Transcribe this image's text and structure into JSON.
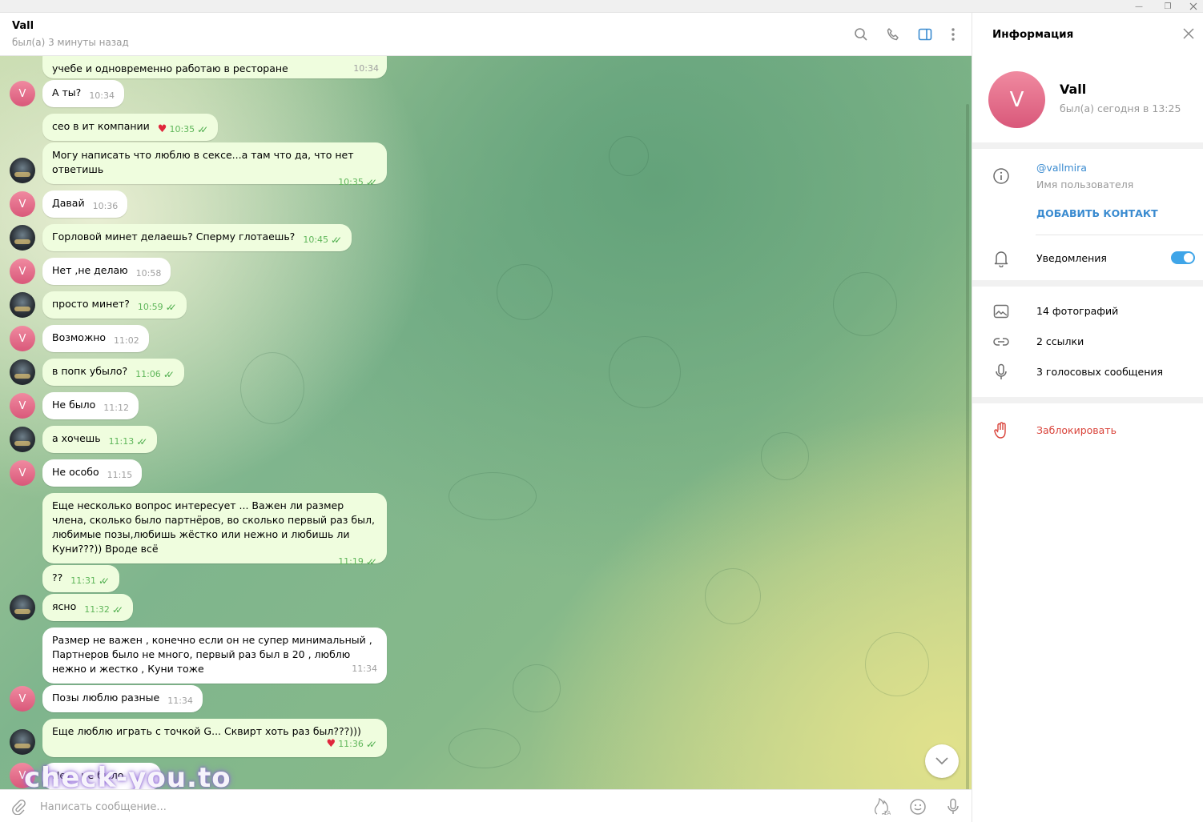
{
  "window": {
    "minimize_glyph": "—",
    "maximize_glyph": "❐"
  },
  "header": {
    "title": "Vall",
    "status": "был(а) 3 минуты назад",
    "icons": [
      "search-icon",
      "phone-icon",
      "sidebar-toggle-icon",
      "more-vertical-icon"
    ]
  },
  "messages": [
    {
      "dir": "out",
      "text": "учебе и одновременно работаю в ресторане",
      "time": "10:34",
      "avatar": "none"
    },
    {
      "dir": "in",
      "text": "А ты?",
      "time": "10:34",
      "avatar": "V"
    },
    {
      "dir": "out",
      "text": "сео в ит компании",
      "time": "10:35",
      "heart": true,
      "read": true,
      "avatar": "none"
    },
    {
      "dir": "out",
      "text": "Могу написать что люблю в сексе...а там что да, что нет ответишь",
      "time": "10:35",
      "read": true,
      "avatar": "photo"
    },
    {
      "dir": "in",
      "text": "Давай",
      "time": "10:36",
      "avatar": "V"
    },
    {
      "dir": "out",
      "text": "Горловой минет делаешь? Сперму глотаешь?",
      "time": "10:45",
      "read": true,
      "avatar": "photo"
    },
    {
      "dir": "in",
      "text": "Нет ,не делаю",
      "time": "10:58",
      "avatar": "V"
    },
    {
      "dir": "out",
      "text": "просто минет?",
      "time": "10:59",
      "read": true,
      "avatar": "photo"
    },
    {
      "dir": "in",
      "text": "Возможно",
      "time": "11:02",
      "avatar": "V"
    },
    {
      "dir": "out",
      "text": "в попк убыло?",
      "time": "11:06",
      "read": true,
      "avatar": "photo"
    },
    {
      "dir": "in",
      "text": "Не было",
      "time": "11:12",
      "avatar": "V"
    },
    {
      "dir": "out",
      "text": "а хочешь",
      "time": "11:13",
      "read": true,
      "avatar": "photo"
    },
    {
      "dir": "in",
      "text": "Не особо",
      "time": "11:15",
      "avatar": "V"
    },
    {
      "dir": "out",
      "text": "Еще несколько вопрос интересует ... Важен ли размер члена, сколько было партнёров, во сколько первый раз был, любимые позы,любишь жёстко или нежно и любишь ли Куни???)) Вроде всё",
      "time": "11:19",
      "read": true,
      "avatar": "none"
    },
    {
      "dir": "out",
      "text": "??",
      "time": "11:31",
      "read": true,
      "avatar": "none"
    },
    {
      "dir": "out",
      "text": "ясно",
      "time": "11:32",
      "read": true,
      "avatar": "photo"
    },
    {
      "dir": "in",
      "text": "Размер не важен , конечно если он не супер минимальный , Партнеров было не много, первый раз был в 20 , люблю нежно и жестко , Куни тоже",
      "time": "11:34",
      "avatar": "none"
    },
    {
      "dir": "in",
      "text": "Позы люблю разные",
      "time": "11:34",
      "avatar": "V"
    },
    {
      "dir": "out",
      "text": "Еще люблю играть с точкой G... Сквирт хоть раз был???)))",
      "time": "11:36",
      "heart": true,
      "read": true,
      "avatar": "photo"
    },
    {
      "dir": "in",
      "text": "Нет , не было",
      "time": "",
      "avatar": "V"
    }
  ],
  "watermark": "check-you.to",
  "composer": {
    "placeholder": "Написать сообщение...",
    "icons": [
      "attach-icon",
      "emoji-icon",
      "microphone-icon"
    ]
  },
  "info": {
    "title": "Информация",
    "name": "Vall",
    "avatar_letter": "V",
    "seen": "был(а) сегодня в 13:25",
    "username": "@vallmira",
    "username_label": "Имя пользователя",
    "add_contact": "ДОБАВИТЬ КОНТАКТ",
    "notifications": "Уведомления",
    "notifications_on": true,
    "photos": "14 фотографий",
    "links": "2 ссылки",
    "voice": "3 голосовых сообщения",
    "block": "Заблокировать"
  },
  "colors": {
    "accent": "#3a8bd0",
    "outgoing_bubble": "#effdde",
    "incoming_bubble": "#ffffff",
    "read_check": "#4fae4e",
    "danger": "#d9433a",
    "avatar_pink": "#e0687f"
  }
}
